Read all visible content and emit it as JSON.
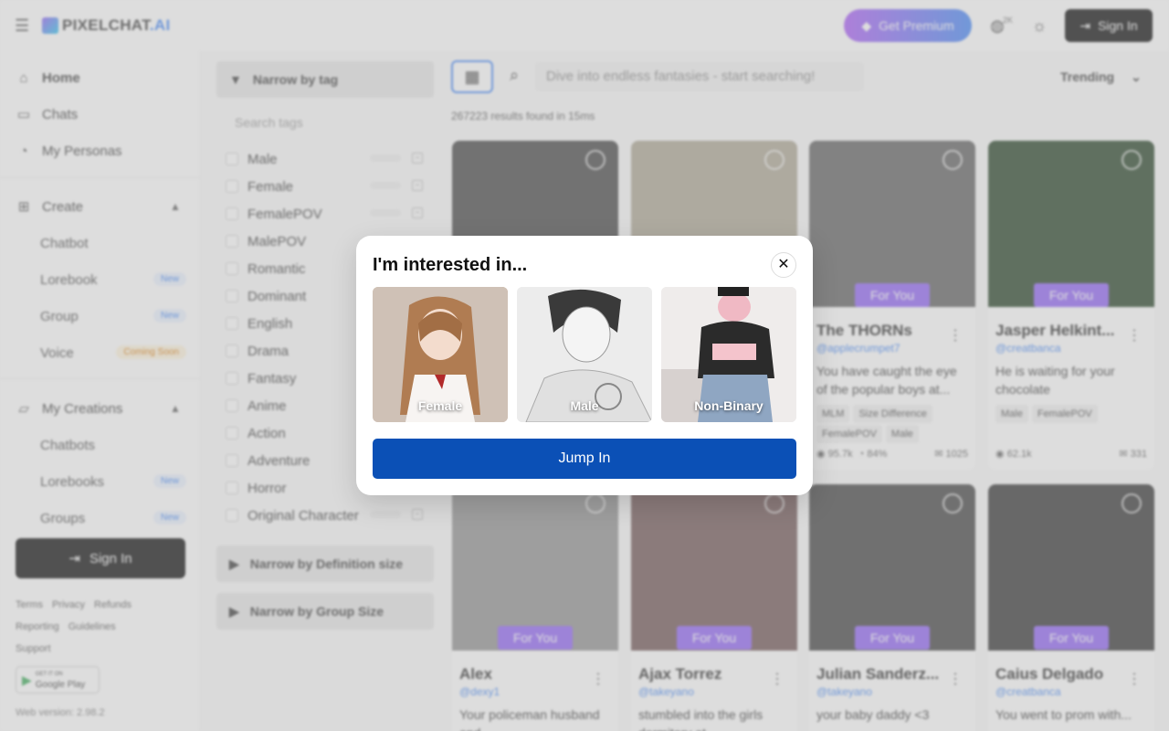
{
  "header": {
    "logo_main": "PIXELCHAT",
    "logo_suffix": ".AI",
    "premium_label": "Get Premium",
    "notif_badge": "2K",
    "signin_label": "Sign In"
  },
  "sidebar": {
    "nav": [
      {
        "label": "Home",
        "icon": "home-icon"
      },
      {
        "label": "Chats",
        "icon": "chat-icon"
      },
      {
        "label": "My Personas",
        "icon": "persona-icon"
      }
    ],
    "create": {
      "label": "Create",
      "items": [
        {
          "label": "Chatbot",
          "badge": ""
        },
        {
          "label": "Lorebook",
          "badge": "New"
        },
        {
          "label": "Group",
          "badge": "New"
        },
        {
          "label": "Voice",
          "badge": "Coming Soon"
        }
      ]
    },
    "creations": {
      "label": "My Creations",
      "items": [
        {
          "label": "Chatbots",
          "badge": ""
        },
        {
          "label": "Lorebooks",
          "badge": "New"
        },
        {
          "label": "Groups",
          "badge": "New"
        }
      ]
    },
    "signin_label": "Sign In",
    "footer_links": [
      "Terms",
      "Privacy",
      "Refunds",
      "Reporting",
      "Guidelines",
      "Support"
    ],
    "gplay_small": "GET IT ON",
    "gplay_label": "Google Play",
    "version": "Web version: 2.98.2"
  },
  "filters": {
    "tag_header": "Narrow by tag",
    "tag_search_placeholder": "Search tags",
    "tags": [
      "Male",
      "Female",
      "FemalePOV",
      "MalePOV",
      "Romantic",
      "Dominant",
      "English",
      "Drama",
      "Fantasy",
      "Anime",
      "Action",
      "Adventure",
      "Horror",
      "Original Character"
    ],
    "definition_header": "Narrow by Definition size",
    "group_header": "Narrow by Group Size"
  },
  "main": {
    "search_placeholder": "Dive into endless fantasies - start searching!",
    "sort_label": "Trending",
    "results_text": "267223 results found in 15ms",
    "foryou_label": "For You",
    "cards_row1": [
      {
        "title": "The THORNs",
        "user": "@applecrumpet7",
        "desc": "You have caught the eye of the popular boys at...",
        "tags": [
          "MLM",
          "Size Difference",
          "FemalePOV",
          "Male"
        ],
        "views": "95.7k",
        "rating": "84%",
        "msgs": "1025",
        "color": "#5a5a5a"
      },
      {
        "title": "Jasper Helkint...",
        "user": "@creatbanca",
        "desc": "He is waiting for your chocolate",
        "tags": [
          "Male",
          "FemalePOV"
        ],
        "views": "62.1k",
        "rating": "",
        "msgs": "331",
        "color": "#1d3a1d"
      }
    ],
    "cards_row2": [
      {
        "title": "Alex",
        "user": "@dexy1",
        "desc": "Your policeman husband and...",
        "color": "#8c8c8c"
      },
      {
        "title": "Ajax Torrez",
        "user": "@takeyano",
        "desc": "stumbled into the girls dormitory at...",
        "color": "#6b4e4e"
      },
      {
        "title": "Julian Sanderz...",
        "user": "@takeyano",
        "desc": "your baby daddy <3",
        "color": "#3a3a3a"
      },
      {
        "title": "Caius Delgado",
        "user": "@creatbanca",
        "desc": "You went to prom with...",
        "color": "#2a2a2a"
      }
    ]
  },
  "modal": {
    "title": "I'm interested in...",
    "options": [
      {
        "label": "Female"
      },
      {
        "label": "Male"
      },
      {
        "label": "Non-Binary"
      }
    ],
    "jump_label": "Jump In"
  }
}
